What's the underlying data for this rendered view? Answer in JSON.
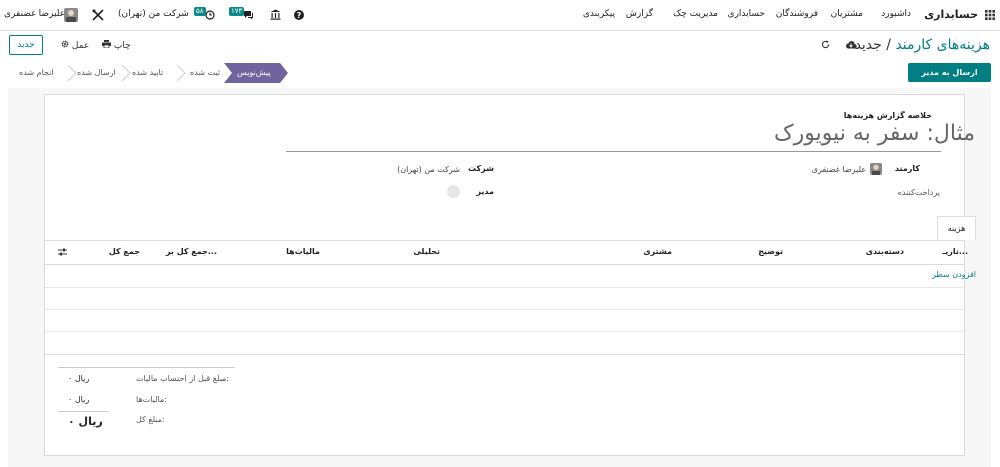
{
  "navbar": {
    "app_name": "حسابداری",
    "menu": [
      "داشبورد",
      "مشتریان",
      "فروشندگان",
      "حسابداری",
      "مدیریت چک",
      "گزارش",
      "پیکربندی"
    ],
    "company": "شرکت من (تهران)",
    "user": "علیرضا غضنفری",
    "activity_badge": "۵۸",
    "messages_badge": "۱۷۳"
  },
  "control": {
    "new_button": "جدید",
    "print_label": "چاپ",
    "action_label": "عمل",
    "breadcrumb_parent": "هزینه‌های کارمند",
    "breadcrumb_current": "جدید"
  },
  "status": {
    "submit_button": "ارسال به مدیر",
    "stages": [
      "پیش‌نویس",
      "ثبت شده",
      "تایید شده",
      "ارسال شده",
      "انجام شده"
    ],
    "active_stage": "پیش‌نویس"
  },
  "form": {
    "summary_label": "خلاصه گزارش هزینه‌ها",
    "title": "مثال: سفر به نیویورک",
    "employee_label": "کارمند",
    "employee_value": "علیرضا غضنفری",
    "payer_label": "پرداخت‌کننده",
    "company_label": "شرکت",
    "company_value": "شرکت من (تهران)",
    "manager_label": "مدیر",
    "tab_label": "هزینه"
  },
  "table": {
    "columns": [
      "تاریـ...",
      "دسته‌بندی",
      "توضیح",
      "مشتری",
      "تحلیلی",
      "مالیات‌ها",
      "جمع کل بر...",
      "جمع کل"
    ],
    "add_line": "افزودن سطر"
  },
  "totals": {
    "untaxed_label": "مبلغ قبل از احتساب مالیات:",
    "untaxed_value": "۰ ریال",
    "taxes_label": "مالیات‌ها:",
    "taxes_value": "۰ ریال",
    "total_label": "مبلغ کل:",
    "total_value": "۰ ریال"
  }
}
